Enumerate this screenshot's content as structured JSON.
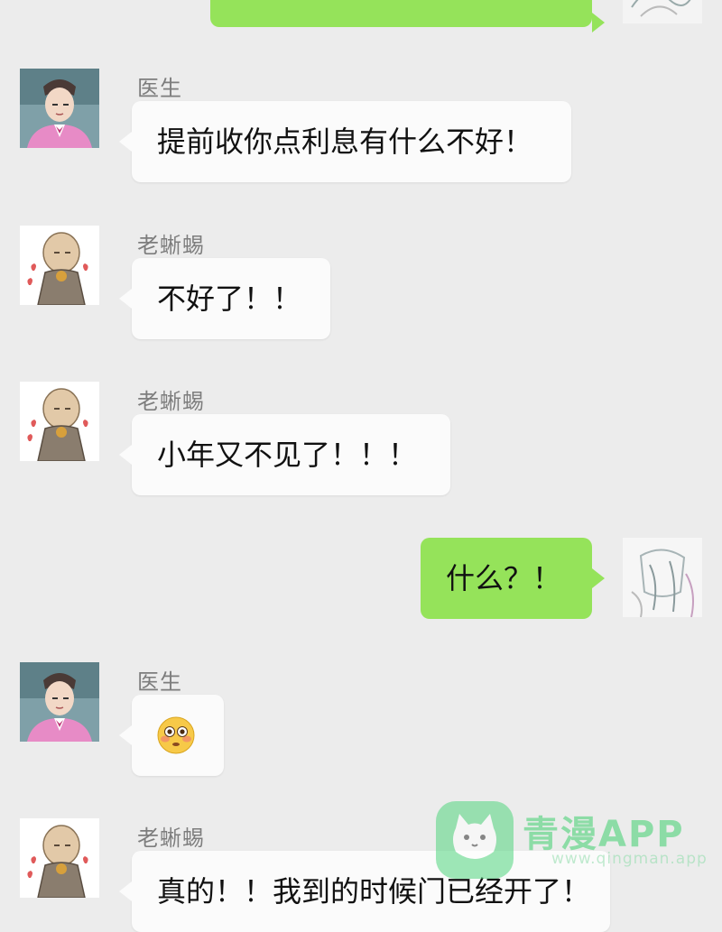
{
  "messages": [
    {
      "side": "out",
      "sender": "",
      "text": ""
    },
    {
      "side": "in",
      "sender": "医生",
      "avatar": "doctor",
      "text": "提前收你点利息有什么不好！"
    },
    {
      "side": "in",
      "sender": "老蜥蜴",
      "avatar": "old-lizard",
      "text": "不好了！！"
    },
    {
      "side": "in",
      "sender": "老蜥蜴",
      "avatar": "old-lizard",
      "text": "小年又不见了！！！"
    },
    {
      "side": "out",
      "sender": "",
      "avatar": "self",
      "text": "什么？！"
    },
    {
      "side": "in",
      "sender": "医生",
      "avatar": "doctor",
      "text": "",
      "emoji": "flushed-face-emoji"
    },
    {
      "side": "in",
      "sender": "老蜥蜴",
      "avatar": "old-lizard",
      "text": "真的！！我到的时候门已经开了！"
    }
  ],
  "watermark": {
    "title": "青漫APP",
    "url": "www.qingman.app"
  },
  "colors": {
    "background": "#ececec",
    "incoming_bubble": "#fbfbfb",
    "outgoing_bubble": "#95e35a",
    "sender_name": "#7d7d7d"
  }
}
